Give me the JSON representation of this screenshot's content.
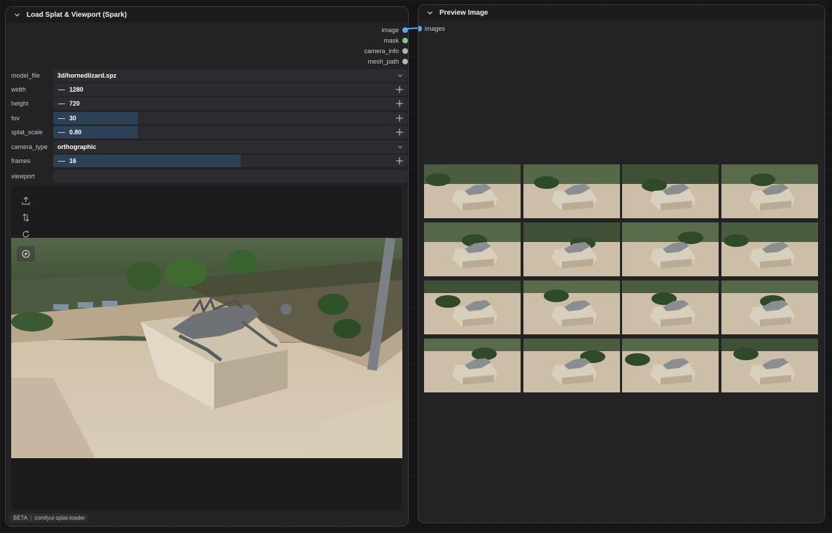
{
  "left_node": {
    "title": "Load Splat & Viewport (Spark)",
    "outputs": [
      {
        "label": "image",
        "color": "#5aa8ee"
      },
      {
        "label": "mask",
        "color": "#7fcf7a"
      },
      {
        "label": "camera_info",
        "color": "#b5b5b5"
      },
      {
        "label": "mesh_path",
        "color": "#b5b5b5"
      }
    ],
    "widgets": {
      "model_file": {
        "label": "model_file",
        "value": "3d/hornedlizard.spz"
      },
      "width": {
        "label": "width",
        "value": "1280"
      },
      "height": {
        "label": "height",
        "value": "720"
      },
      "fov": {
        "label": "fov",
        "value": "30",
        "fill_fraction": 0.24
      },
      "splat_scale": {
        "label": "splat_scale",
        "value": "0.80",
        "fill_fraction": 0.24
      },
      "camera_type": {
        "label": "camera_type",
        "value": "orthographic"
      },
      "frames": {
        "label": "frames",
        "value": "16",
        "fill_fraction": 0.53
      },
      "viewport": {
        "label": "viewport"
      }
    },
    "viewport_toolbar": [
      "upload-icon",
      "swap-vertical-icon",
      "reset-icon",
      "compass-icon"
    ],
    "footer": {
      "badge": "BETA",
      "source": "comfyui-splat-loader"
    }
  },
  "right_node": {
    "title": "Preview Image",
    "input": {
      "label": "images",
      "color": "#5aa8ee"
    },
    "grid_count": 16
  }
}
